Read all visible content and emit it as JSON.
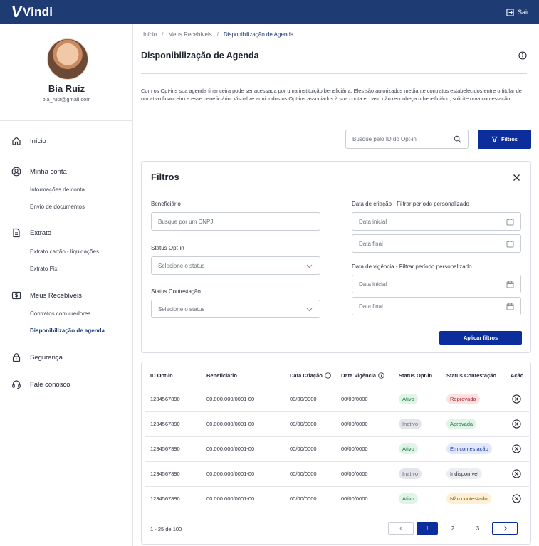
{
  "header": {
    "brand": "Vindi",
    "logout_label": "Sair"
  },
  "profile": {
    "name": "Bia Ruiz",
    "email": "bia_ruiz@gmail.com"
  },
  "sidebar": {
    "sections": [
      {
        "label": "Início",
        "icon": "home-icon"
      },
      {
        "label": "Minha conta",
        "icon": "user-circle-icon",
        "items": [
          "Informações de conta",
          "Envio de documentos"
        ]
      },
      {
        "label": "Extrato",
        "icon": "document-icon",
        "items": [
          "Extrato cartão - liquidações",
          "Extrato Pix"
        ]
      },
      {
        "label": "Meus Recebíveis",
        "icon": "dollar-box-icon",
        "items": [
          "Contratos com credores",
          "Disponibilização de agenda"
        ]
      },
      {
        "label": "Segurança",
        "icon": "lock-icon"
      },
      {
        "label": "Fale conosco",
        "icon": "headset-icon"
      }
    ],
    "active_item": "Disponibilização de agenda"
  },
  "breadcrumb": [
    "Início",
    "Meus Recebíveis",
    "Disponibilização de Agenda"
  ],
  "page": {
    "title": "Disponibilização de Agenda",
    "description": "Com os Opt-ins sua agenda financeira pode ser acessada por uma instituição beneficiária. Eles são autorizados mediante contratos estabelecidos entre o titular de um ativo financeiro e esse beneficiário. Visualize aqui todos os Opt-ins associados à sua conta e, caso não reconheça o beneficiário, solicite uma contestação."
  },
  "search": {
    "placeholder": "Busque pelo ID do Opt-in",
    "filter_button": "Filtros"
  },
  "filters": {
    "title": "Filtros",
    "beneficiary_label": "Beneficiário",
    "beneficiary_placeholder": "Busque por um CNPJ",
    "optin_status_label": "Status Opt-in",
    "optin_status_placeholder": "Selecione o status",
    "contest_status_label": "Status Contestação",
    "contest_status_placeholder": "Selecione o status",
    "creation_label": "Data de criação - Filtrar período personalizado",
    "validity_label": "Data de vigência - Filtrar período personalizado",
    "start_date_placeholder": "Data inicial",
    "end_date_placeholder": "Data final",
    "apply_button": "Aplicar filtros"
  },
  "table": {
    "columns": [
      "ID Opt-in",
      "Beneficiário",
      "Data Criação",
      "Data Vigência",
      "Status Opt-in",
      "Status Contestação",
      "Ação"
    ],
    "rows": [
      {
        "id": "1234567890",
        "beneficiary": "00.000.000/0001-00",
        "created": "00/00/0000",
        "validity": "00/00/0000",
        "optin_status": "Ativo",
        "contest_status": "Reprovada"
      },
      {
        "id": "1234567890",
        "beneficiary": "00.000.000/0001-00",
        "created": "00/00/0000",
        "validity": "00/00/0000",
        "optin_status": "Inativo",
        "contest_status": "Aprovada"
      },
      {
        "id": "1234567890",
        "beneficiary": "00.000.000/0001-00",
        "created": "00/00/0000",
        "validity": "00/00/0000",
        "optin_status": "Ativo",
        "contest_status": "Em contestação"
      },
      {
        "id": "1234567890",
        "beneficiary": "00.000.000/0001-00",
        "created": "00/00/0000",
        "validity": "00/00/0000",
        "optin_status": "Inativo",
        "contest_status": "Indisponível"
      },
      {
        "id": "1234567890",
        "beneficiary": "00.000.000/0001-00",
        "created": "00/00/0000",
        "validity": "00/00/0000",
        "optin_status": "Ativo",
        "contest_status": "Não contestado"
      }
    ]
  },
  "pagination": {
    "count_label": "1 - 25 de 100",
    "pages": [
      "1",
      "2",
      "3"
    ],
    "current_page": "1"
  },
  "colors": {
    "brand": "#1f3b73",
    "primary_button": "#0c2e9c",
    "badge_active_bg": "#dff3e6",
    "badge_active_text": "#1f7a45",
    "badge_inactive_bg": "#e3e5ea",
    "badge_inactive_text": "#6a707c",
    "badge_reprovada_bg": "#fde2e2",
    "badge_reprovada_text": "#b4232a",
    "badge_aprovada_bg": "#dff3e6",
    "badge_aprovada_text": "#1f7a45",
    "badge_contestacao_bg": "#e2e8fb",
    "badge_contestacao_text": "#1f3b9c",
    "badge_indisponivel_bg": "#eceef2",
    "badge_indisponivel_text": "#2f3440",
    "badge_nao_contestado_bg": "#fdf0d5",
    "badge_nao_contestado_text": "#8a5a00"
  }
}
